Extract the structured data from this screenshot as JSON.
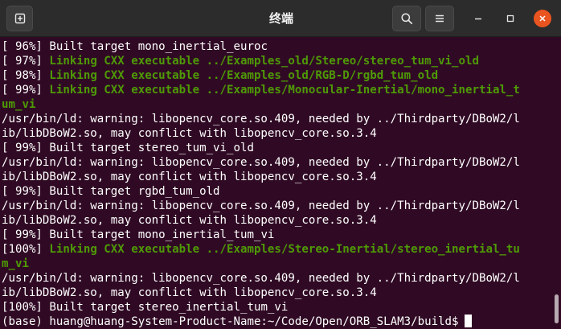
{
  "window": {
    "title": "终端"
  },
  "colors": {
    "terminal_bg": "#300a24",
    "titlebar_bg": "#2c2c2c",
    "green": "#4e9a06",
    "close_button": "#e95420"
  },
  "icons": {
    "new_tab": "plus-in-square-icon",
    "search": "magnifier-icon",
    "menu": "hamburger-icon",
    "minimize": "minimize-icon",
    "maximize": "maximize-icon",
    "close": "close-icon"
  },
  "lines": [
    {
      "prefix": "[ 96%] ",
      "text": "Built target mono_inertial_euroc"
    },
    {
      "prefix": "[ 97%] ",
      "green": "Linking CXX executable ../Examples_old/Stereo/stereo_tum_vi_old"
    },
    {
      "prefix": "[ 98%] ",
      "green": "Linking CXX executable ../Examples_old/RGB-D/rgbd_tum_old"
    },
    {
      "prefix": "[ 99%] ",
      "green": "Linking CXX executable ../Examples/Monocular-Inertial/mono_inertial_t"
    },
    {
      "prefix": "",
      "green": "um_vi"
    },
    {
      "prefix": "",
      "text": "/usr/bin/ld: warning: libopencv_core.so.409, needed by ../Thirdparty/DBoW2/l"
    },
    {
      "prefix": "",
      "text": "ib/libDBoW2.so, may conflict with libopencv_core.so.3.4"
    },
    {
      "prefix": "[ 99%] ",
      "text": "Built target stereo_tum_vi_old"
    },
    {
      "prefix": "",
      "text": "/usr/bin/ld: warning: libopencv_core.so.409, needed by ../Thirdparty/DBoW2/l"
    },
    {
      "prefix": "",
      "text": "ib/libDBoW2.so, may conflict with libopencv_core.so.3.4"
    },
    {
      "prefix": "[ 99%] ",
      "text": "Built target rgbd_tum_old"
    },
    {
      "prefix": "",
      "text": "/usr/bin/ld: warning: libopencv_core.so.409, needed by ../Thirdparty/DBoW2/l"
    },
    {
      "prefix": "",
      "text": "ib/libDBoW2.so, may conflict with libopencv_core.so.3.4"
    },
    {
      "prefix": "[ 99%] ",
      "text": "Built target mono_inertial_tum_vi"
    },
    {
      "prefix": "[100%] ",
      "green": "Linking CXX executable ../Examples/Stereo-Inertial/stereo_inertial_tu"
    },
    {
      "prefix": "",
      "green": "m_vi"
    },
    {
      "prefix": "",
      "text": "/usr/bin/ld: warning: libopencv_core.so.409, needed by ../Thirdparty/DBoW2/l"
    },
    {
      "prefix": "",
      "text": "ib/libDBoW2.so, may conflict with libopencv_core.so.3.4"
    },
    {
      "prefix": "[100%] ",
      "text": "Built target stereo_inertial_tum_vi"
    }
  ],
  "prompt": "(base) huang@huang-System-Product-Name:~/Code/Open/ORB_SLAM3/build$"
}
